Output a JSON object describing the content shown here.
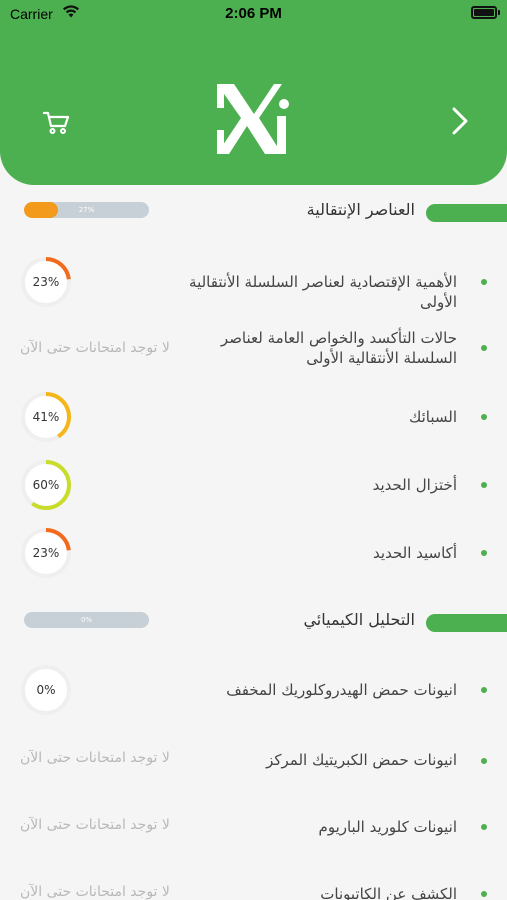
{
  "status_bar": {
    "carrier": "Carrier",
    "time": "2:06 PM"
  },
  "header": {
    "brand_color": "#4cb050",
    "cart_icon": "cart-icon",
    "next_icon": "chevron-right-icon",
    "logo_icon": "xi-logo-icon"
  },
  "sections": [
    {
      "title": "العناصر الإنتقالية",
      "progress_text": "27%",
      "progress": 0.27,
      "items": [
        {
          "title": "الأهمية الإقتصادية لعناصر السلسلة الأنتقالية الأولى",
          "ring_text": "23%",
          "ring_value": 0.23,
          "ring_color": "#f26b1d"
        },
        {
          "title": "حالات التأكسد والخواص العامة لعناصر السلسلة الأنتقالية الأولى",
          "no_exam": "لا توجد امتحانات حتى الآن"
        },
        {
          "title": "السبائك",
          "ring_text": "41%",
          "ring_value": 0.41,
          "ring_color": "#f5b61b"
        },
        {
          "title": "أختزال الحديد",
          "ring_text": "60%",
          "ring_value": 0.6,
          "ring_color": "#c9dc2a"
        },
        {
          "title": "أكاسيد الحديد",
          "ring_text": "23%",
          "ring_value": 0.23,
          "ring_color": "#f26b1d"
        }
      ]
    },
    {
      "title": "التحليل الكيميائي",
      "progress_text": "0%",
      "progress": 0,
      "items": [
        {
          "title": "انيونات حمض الهيدروكلوريك المخفف",
          "ring_text": "0%",
          "ring_value": 0,
          "ring_color": "#f26b1d"
        },
        {
          "title": "انيونات حمض الكبريتيك المركز",
          "no_exam": "لا توجد امتحانات حتى الآن"
        },
        {
          "title": "انيونات كلوريد الباريوم",
          "no_exam": "لا توجد امتحانات حتى الآن"
        },
        {
          "title": "الكشف عن الكاتيونات",
          "no_exam": "لا توجد امتحانات حتى الآن"
        }
      ]
    }
  ]
}
